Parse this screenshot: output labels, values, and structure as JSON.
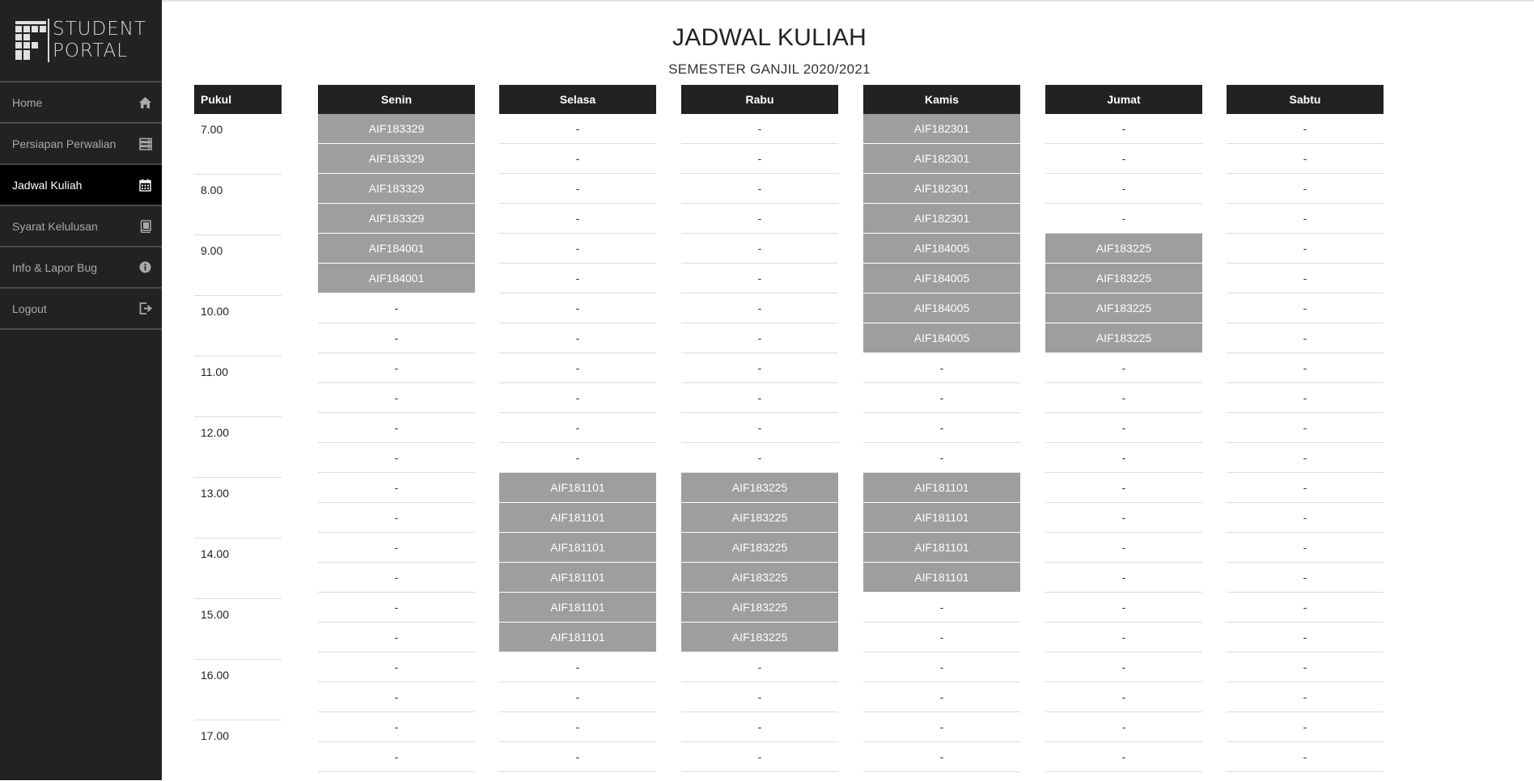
{
  "brand": {
    "line1": "STUDENT",
    "line2": "PORTAL"
  },
  "sidebar": {
    "items": [
      {
        "label": "Home",
        "icon": "home-icon",
        "active": false
      },
      {
        "label": "Persiapan Perwalian",
        "icon": "server-icon",
        "active": false
      },
      {
        "label": "Jadwal Kuliah",
        "icon": "calendar-icon",
        "active": true
      },
      {
        "label": "Syarat Kelulusan",
        "icon": "book-icon",
        "active": false
      },
      {
        "label": "Info & Lapor Bug",
        "icon": "info-icon",
        "active": false
      },
      {
        "label": "Logout",
        "icon": "logout-icon",
        "active": false
      }
    ]
  },
  "page": {
    "title": "JADWAL KULIAH",
    "subtitle": "SEMESTER GANJIL 2020/2021"
  },
  "schedule": {
    "time_header": "Pukul",
    "times": [
      "7.00",
      "8.00",
      "9.00",
      "10.00",
      "11.00",
      "12.00",
      "13.00",
      "14.00",
      "15.00",
      "16.00",
      "17.00"
    ],
    "empty_marker": "-",
    "days": [
      {
        "name": "Senin",
        "slots": [
          "AIF183329",
          "AIF183329",
          "AIF183329",
          "AIF183329",
          "AIF184001",
          "AIF184001",
          "-",
          "-",
          "-",
          "-",
          "-",
          "-",
          "-",
          "-",
          "-",
          "-",
          "-",
          "-",
          "-",
          "-",
          "-",
          "-"
        ]
      },
      {
        "name": "Selasa",
        "slots": [
          "-",
          "-",
          "-",
          "-",
          "-",
          "-",
          "-",
          "-",
          "-",
          "-",
          "-",
          "-",
          "AIF181101",
          "AIF181101",
          "AIF181101",
          "AIF181101",
          "AIF181101",
          "AIF181101",
          "-",
          "-",
          "-",
          "-"
        ]
      },
      {
        "name": "Rabu",
        "slots": [
          "-",
          "-",
          "-",
          "-",
          "-",
          "-",
          "-",
          "-",
          "-",
          "-",
          "-",
          "-",
          "AIF183225",
          "AIF183225",
          "AIF183225",
          "AIF183225",
          "AIF183225",
          "AIF183225",
          "-",
          "-",
          "-",
          "-"
        ]
      },
      {
        "name": "Kamis",
        "slots": [
          "AIF182301",
          "AIF182301",
          "AIF182301",
          "AIF182301",
          "AIF184005",
          "AIF184005",
          "AIF184005",
          "AIF184005",
          "-",
          "-",
          "-",
          "-",
          "AIF181101",
          "AIF181101",
          "AIF181101",
          "AIF181101",
          "-",
          "-",
          "-",
          "-",
          "-",
          "-"
        ]
      },
      {
        "name": "Jumat",
        "slots": [
          "-",
          "-",
          "-",
          "-",
          "AIF183225",
          "AIF183225",
          "AIF183225",
          "AIF183225",
          "-",
          "-",
          "-",
          "-",
          "-",
          "-",
          "-",
          "-",
          "-",
          "-",
          "-",
          "-",
          "-",
          "-"
        ]
      },
      {
        "name": "Sabtu",
        "slots": [
          "-",
          "-",
          "-",
          "-",
          "-",
          "-",
          "-",
          "-",
          "-",
          "-",
          "-",
          "-",
          "-",
          "-",
          "-",
          "-",
          "-",
          "-",
          "-",
          "-",
          "-",
          "-"
        ]
      }
    ]
  },
  "colors": {
    "sidebar_bg": "#222222",
    "active_bg": "#000000",
    "header_bg": "#222222",
    "filled_bg": "#9e9e9e"
  }
}
